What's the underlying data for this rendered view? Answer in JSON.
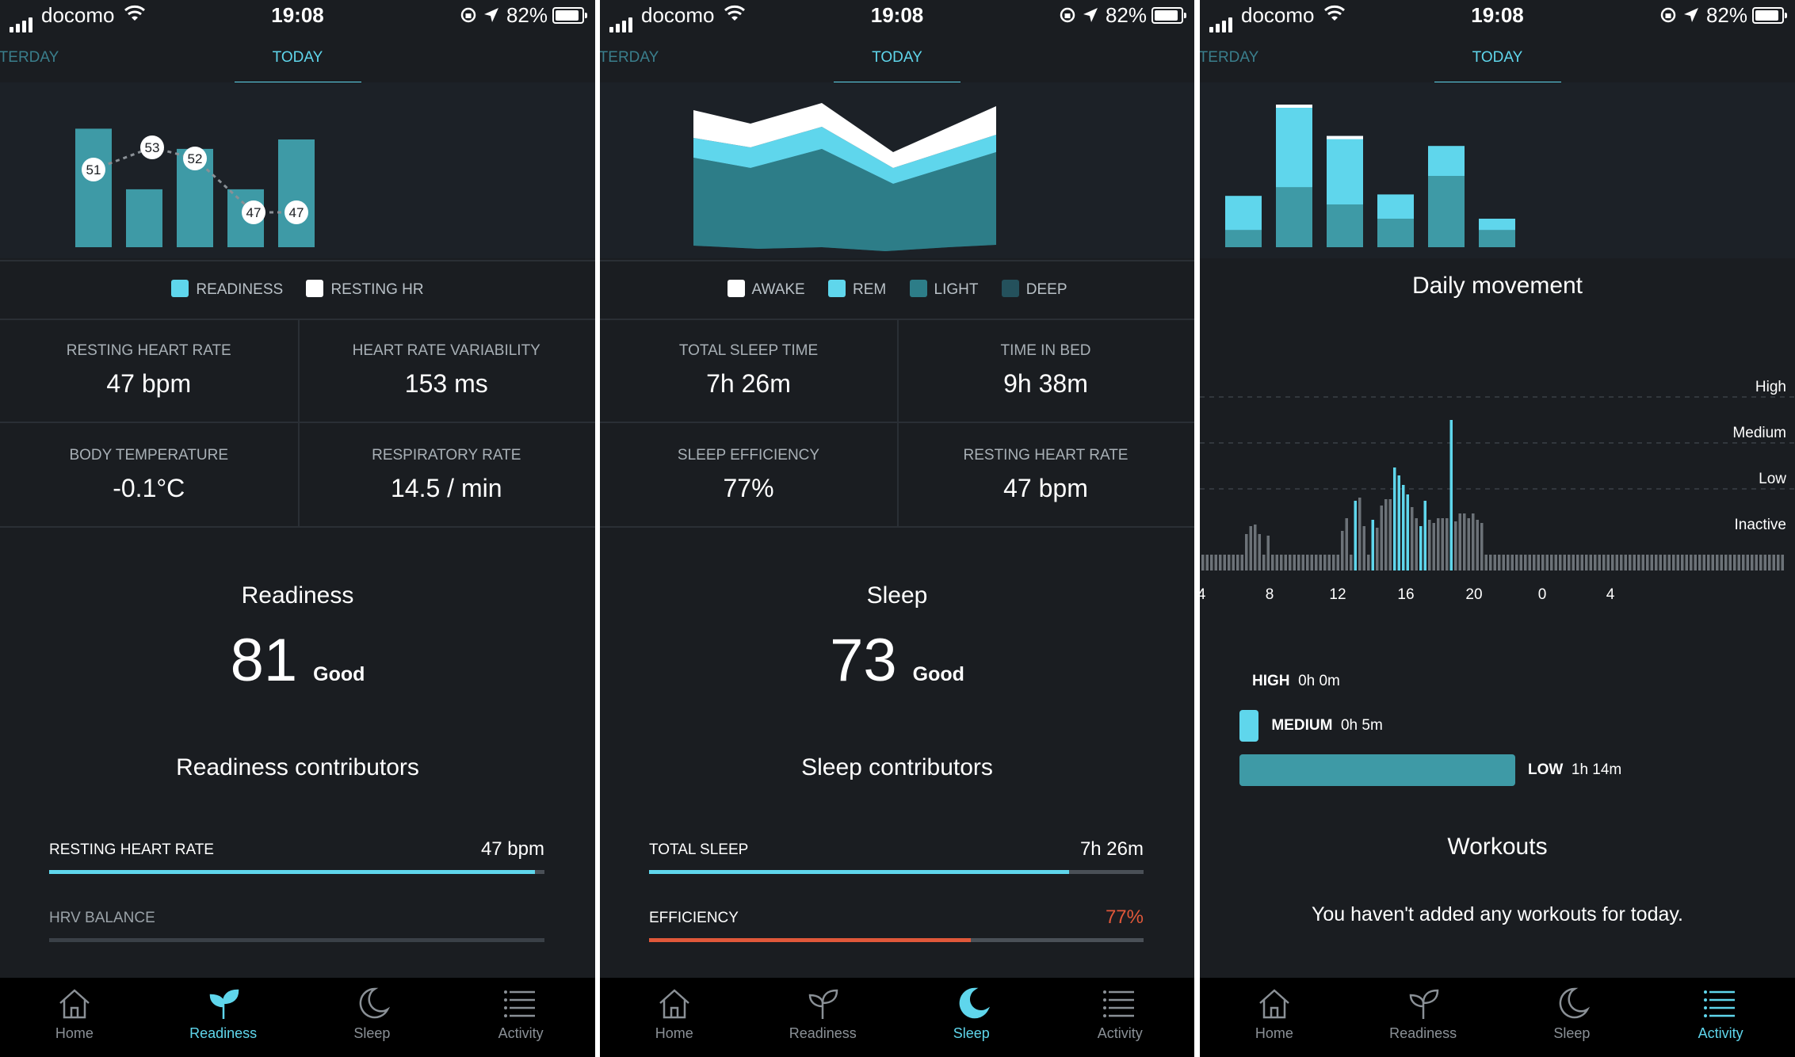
{
  "status": {
    "carrier": "docomo",
    "time": "19:08",
    "battery": "82%"
  },
  "tabs": {
    "yesterday": "STERDAY",
    "today": "TODAY"
  },
  "nav": [
    "Home",
    "Readiness",
    "Sleep",
    "Activity"
  ],
  "colors": {
    "accent": "#5fd6ec",
    "bar": "#3e9aa6",
    "background": "#1a1d21",
    "orange": "#e0583a"
  },
  "screens": [
    {
      "active_nav": "Readiness",
      "chart_data": {
        "type": "bar",
        "bars": [
          0.88,
          0.43,
          0.73,
          0.43,
          0.8
        ],
        "resting_hr_labels": [
          "51",
          "53",
          "52",
          "47",
          "47"
        ],
        "series": [
          {
            "name": "READINESS"
          },
          {
            "name": "RESTING HR"
          }
        ]
      },
      "legend": [
        "READINESS",
        "RESTING HR"
      ],
      "metrics": [
        {
          "label": "RESTING HEART RATE",
          "value": "47 bpm"
        },
        {
          "label": "HEART RATE VARIABILITY",
          "value": "153 ms"
        },
        {
          "label": "BODY TEMPERATURE",
          "value": "-0.1°C"
        },
        {
          "label": "RESPIRATORY RATE",
          "value": "14.5 / min"
        }
      ],
      "score_title": "Readiness",
      "score": "81",
      "score_label": "Good",
      "contributors_title": "Readiness contributors",
      "contributors": [
        {
          "label": "RESTING HEART RATE",
          "value": "47 bpm",
          "fill": 0.98
        },
        {
          "label": "HRV BALANCE",
          "value": "",
          "fill": 0
        }
      ]
    },
    {
      "active_nav": "Sleep",
      "chart_data": {
        "type": "area",
        "series": [
          {
            "name": "AWAKE"
          },
          {
            "name": "REM"
          },
          {
            "name": "LIGHT"
          },
          {
            "name": "DEEP"
          }
        ]
      },
      "legend": [
        "AWAKE",
        "REM",
        "LIGHT",
        "DEEP"
      ],
      "metrics": [
        {
          "label": "TOTAL SLEEP TIME",
          "value": "7h 26m"
        },
        {
          "label": "TIME IN BED",
          "value": "9h 38m"
        },
        {
          "label": "SLEEP EFFICIENCY",
          "value": "77%"
        },
        {
          "label": "RESTING HEART RATE",
          "value": "47 bpm"
        }
      ],
      "score_title": "Sleep",
      "score": "73",
      "score_label": "Good",
      "contributors_title": "Sleep contributors",
      "contributors": [
        {
          "label": "TOTAL SLEEP",
          "value": "7h 26m",
          "fill": 0.85
        },
        {
          "label": "EFFICIENCY",
          "value": "77%",
          "fill": 0.65
        }
      ]
    },
    {
      "active_nav": "Activity",
      "chart_data": {
        "type": "bar",
        "bars": [
          {
            "total": 0.36,
            "light": 0.12
          },
          {
            "total": 1.0,
            "light": 0.42
          },
          {
            "total": 0.78,
            "light": 0.3
          },
          {
            "total": 0.37,
            "light": 0.2
          },
          {
            "total": 0.71,
            "light": 0.5
          },
          {
            "total": 0.2,
            "light": 0.12
          }
        ]
      },
      "movement_title": "Daily movement",
      "movement_levels": [
        "High",
        "Medium",
        "Low",
        "Inactive"
      ],
      "movement_ticks": [
        "4",
        "8",
        "12",
        "16",
        "20",
        "0",
        "4"
      ],
      "movement_totals": [
        {
          "label": "HIGH",
          "value": "0h 0m",
          "fill": 0
        },
        {
          "label": "MEDIUM",
          "value": "0h 5m",
          "fill": 0.07
        },
        {
          "label": "LOW",
          "value": "1h 14m",
          "fill": 1
        }
      ],
      "workouts_title": "Workouts",
      "workouts_text": "You haven't added any workouts for today."
    }
  ]
}
